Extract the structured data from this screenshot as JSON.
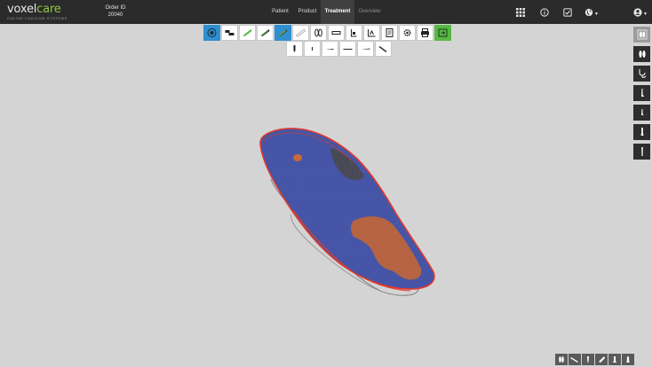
{
  "app": {
    "logo_primary": "voxel",
    "logo_accent": "care",
    "logo_tagline": "ONLINE CAD/CAM SYSTEMS"
  },
  "order": {
    "label": "Order ID",
    "value": "20040"
  },
  "nav": {
    "tabs": [
      {
        "label": "Patient",
        "active": false
      },
      {
        "label": "Product",
        "active": false
      },
      {
        "label": "Treatment",
        "active": true
      },
      {
        "label": "Overview",
        "active": false
      }
    ]
  },
  "header_icons": [
    "apps-grid-icon",
    "info-icon",
    "checklist-icon",
    "globe-icon",
    "user-account-icon"
  ],
  "toolbar_primary": [
    "view-target-icon",
    "layers-icon",
    "insole-green-icon",
    "insole-dark-icon",
    "insole-edit-icon",
    "insole-outline-icon",
    "feet-icon",
    "rectangle-icon",
    "heel-measure-icon",
    "foot-measure-icon",
    "document-icon",
    "gear-icon",
    "print-icon",
    "export-icon"
  ],
  "toolbar_secondary": [
    "pad-tall-icon",
    "pad-small-icon",
    "wedge-flat-icon",
    "wedge-long-icon",
    "wedge-thin-icon",
    "wedge-angled-icon"
  ],
  "side_tools": [
    "feet-view-icon",
    "feet-pair-icon",
    "stethoscope-icon",
    "leg-profile-icon",
    "leg-lower-icon",
    "leg-upper-icon",
    "leg-full-icon"
  ],
  "view_tools": [
    "view-top-icon",
    "view-side-icon",
    "view-front-icon",
    "view-medial-icon",
    "view-heel-icon",
    "view-back-icon"
  ],
  "colors": {
    "topbar": "#2b2b2b",
    "active_tab": "#3f3f3f",
    "brand_green": "#8fc63f",
    "tool_active_blue": "#2f8fd0",
    "tool_green": "#57b844",
    "viewport_bg": "#d4d4d4",
    "insole_blue": "#4a5ab0",
    "insole_orange": "#c8693a",
    "insole_outline_red": "#e03a2e"
  }
}
